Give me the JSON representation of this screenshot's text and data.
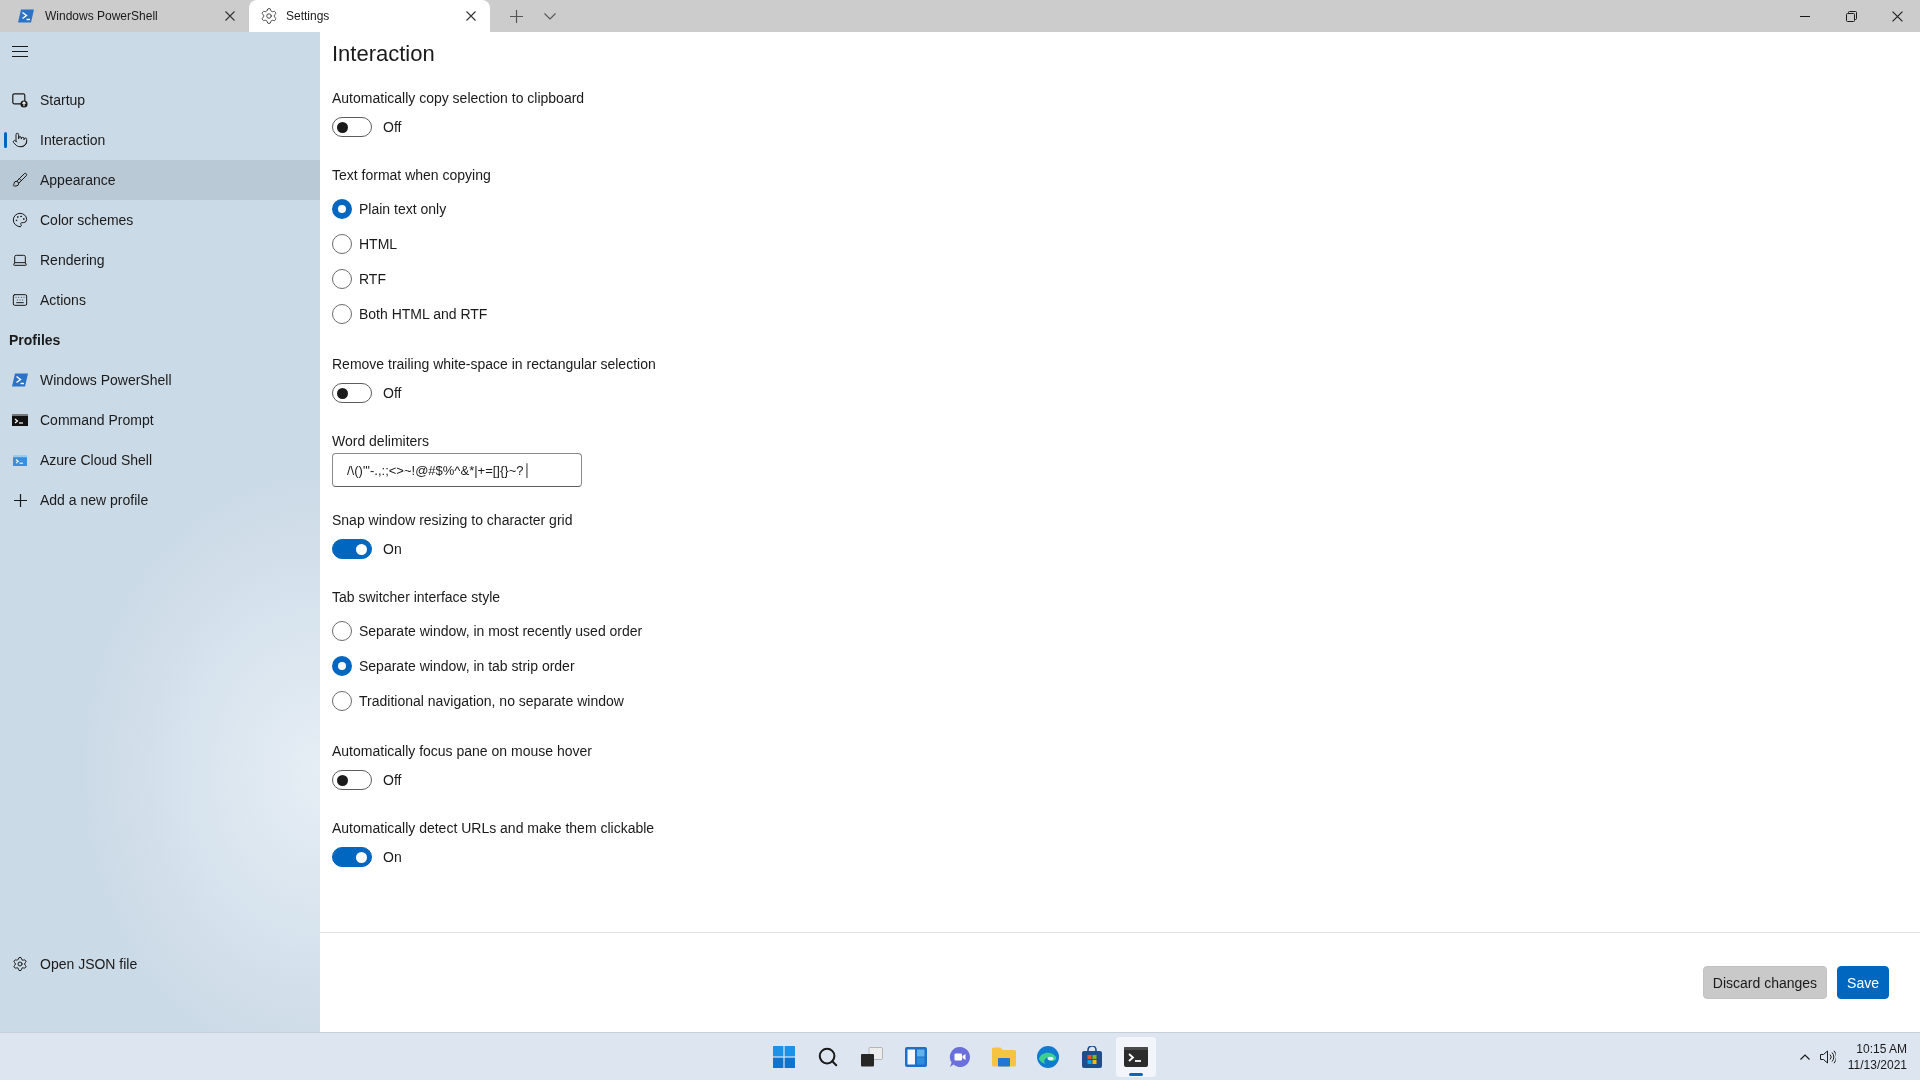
{
  "tabs": [
    {
      "title": "Windows PowerShell",
      "selected": false
    },
    {
      "title": "Settings",
      "selected": true
    }
  ],
  "sidebar": {
    "nav": [
      {
        "label": "Startup",
        "selected": false,
        "hovered": false
      },
      {
        "label": "Interaction",
        "selected": true,
        "hovered": false
      },
      {
        "label": "Appearance",
        "selected": false,
        "hovered": true
      },
      {
        "label": "Color schemes",
        "selected": false,
        "hovered": false
      },
      {
        "label": "Rendering",
        "selected": false,
        "hovered": false
      },
      {
        "label": "Actions",
        "selected": false,
        "hovered": false
      }
    ],
    "profiles_heading": "Profiles",
    "profiles": [
      {
        "label": "Windows PowerShell",
        "selected": false,
        "hovered": false
      },
      {
        "label": "Command Prompt",
        "selected": false,
        "hovered": false
      },
      {
        "label": "Azure Cloud Shell",
        "selected": false,
        "hovered": false
      },
      {
        "label": "Add a new profile",
        "selected": false,
        "hovered": false
      }
    ],
    "footer_item": {
      "label": "Open JSON file"
    }
  },
  "page": {
    "title": "Interaction",
    "settings": [
      {
        "kind": "toggle",
        "label": "Automatically copy selection to clipboard",
        "on": false,
        "state_text": "Off"
      },
      {
        "kind": "radio",
        "label": "Text format when copying",
        "options": [
          {
            "label": "Plain text only",
            "selected": true
          },
          {
            "label": "HTML",
            "selected": false
          },
          {
            "label": "RTF",
            "selected": false
          },
          {
            "label": "Both HTML and RTF",
            "selected": false
          }
        ]
      },
      {
        "kind": "toggle",
        "label": "Remove trailing white-space in rectangular selection",
        "on": false,
        "state_text": "Off"
      },
      {
        "kind": "text",
        "label": "Word delimiters",
        "value": "/\\()\"'-.,:;<>~!@#$%^&*|+=[]{}~?│"
      },
      {
        "kind": "toggle",
        "label": "Snap window resizing to character grid",
        "on": true,
        "state_text": "On"
      },
      {
        "kind": "radio",
        "label": "Tab switcher interface style",
        "options": [
          {
            "label": "Separate window, in most recently used order",
            "selected": false
          },
          {
            "label": "Separate window, in tab strip order",
            "selected": true
          },
          {
            "label": "Traditional navigation, no separate window",
            "selected": false
          }
        ]
      },
      {
        "kind": "toggle",
        "label": "Automatically focus pane on mouse hover",
        "on": false,
        "state_text": "Off"
      },
      {
        "kind": "toggle",
        "label": "Automatically detect URLs and make them clickable",
        "on": true,
        "state_text": "On"
      }
    ]
  },
  "actions": [
    {
      "label": "Discard changes",
      "kind": "secondary"
    },
    {
      "label": "Save",
      "kind": "primary"
    }
  ],
  "taskbar": {
    "apps": [
      {
        "active": false
      },
      {
        "active": false
      },
      {
        "active": false
      },
      {
        "active": false
      },
      {
        "active": false
      },
      {
        "active": false
      },
      {
        "active": false
      },
      {
        "active": false
      },
      {
        "active": true
      }
    ],
    "time": "10:15 AM",
    "date": "11/13/2021"
  }
}
